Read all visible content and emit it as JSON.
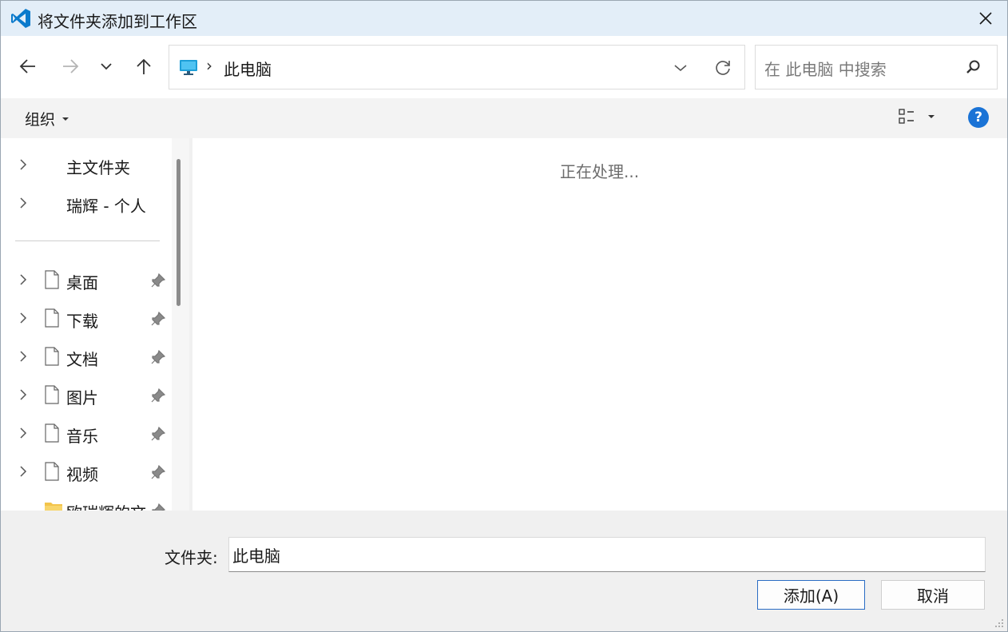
{
  "titlebar": {
    "title": "将文件夹添加到工作区"
  },
  "nav": {
    "address_path": "此电脑",
    "search_placeholder": "在 此电脑 中搜索"
  },
  "cmdbar": {
    "organize_label": "组织"
  },
  "sidebar": {
    "items": [
      {
        "label": "主文件夹",
        "icon": "none",
        "pinned": false
      },
      {
        "label": "瑞辉 - 个人",
        "icon": "none",
        "pinned": false
      },
      {
        "label": "桌面",
        "icon": "document-icon",
        "pinned": true
      },
      {
        "label": "下载",
        "icon": "document-icon",
        "pinned": true
      },
      {
        "label": "文档",
        "icon": "document-icon",
        "pinned": true
      },
      {
        "label": "图片",
        "icon": "document-icon",
        "pinned": true
      },
      {
        "label": "音乐",
        "icon": "document-icon",
        "pinned": true
      },
      {
        "label": "视频",
        "icon": "document-icon",
        "pinned": true
      },
      {
        "label": "欧瑞辉的文",
        "icon": "folder-icon",
        "pinned": true
      }
    ]
  },
  "content": {
    "status_text": "正在处理..."
  },
  "bottom": {
    "folder_label": "文件夹:",
    "folder_value": "此电脑",
    "add_button": "添加(A)",
    "cancel_button": "取消"
  },
  "colors": {
    "accent": "#1a73d6",
    "title_bg": "#e3eef8",
    "vscode_blue": "#0a7acc"
  }
}
